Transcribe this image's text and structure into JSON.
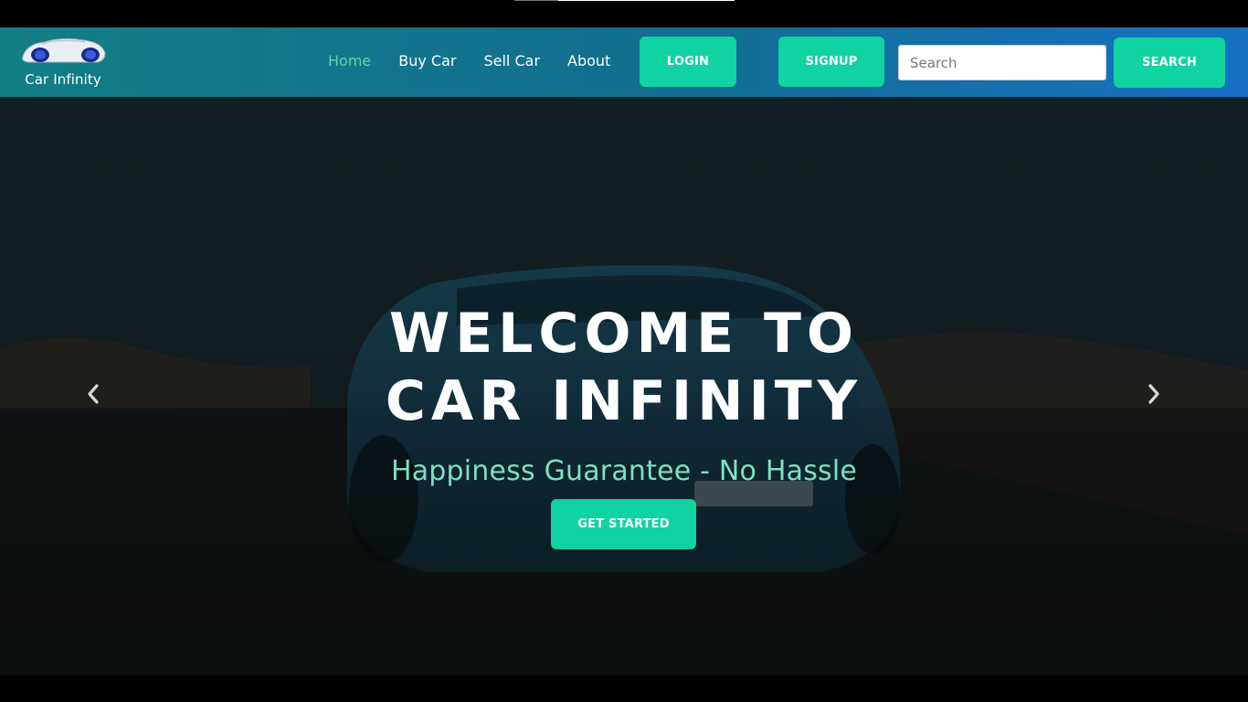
{
  "brand": {
    "name": "Car Infinity",
    "logo_icon": "car-logo-icon"
  },
  "nav": {
    "links": [
      {
        "label": "Home",
        "active": true
      },
      {
        "label": "Buy Car",
        "active": false
      },
      {
        "label": "Sell Car",
        "active": false
      },
      {
        "label": "About",
        "active": false
      }
    ],
    "login_label": "LOGIN",
    "signup_label": "SIGNUP",
    "search_placeholder": "Search",
    "search_label": "SEARCH"
  },
  "hero": {
    "title_line1": "WELCOME TO",
    "title_line2": "CAR INFINITY",
    "subtitle": "Happiness Guarantee - No Hassle",
    "cta_label": "GET STARTED",
    "prev_icon": "chevron-left-icon",
    "next_icon": "chevron-right-icon"
  },
  "colors": {
    "accent": "#0fd3a0",
    "active_link": "#5fd6a8",
    "subtitle": "#7ee0c0",
    "navbar_start": "#127e85",
    "navbar_end": "#1670c4"
  }
}
